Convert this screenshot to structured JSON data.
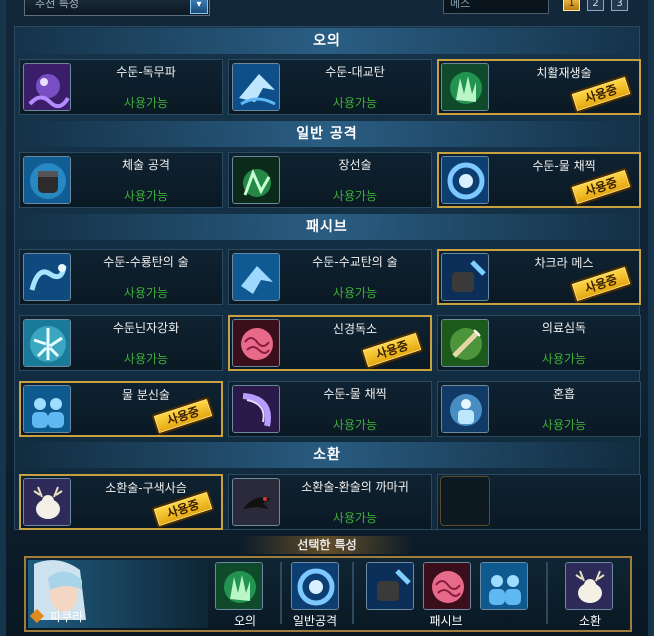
{
  "topbar": {
    "dropdown_label": "추천 특성",
    "currency_label": "메스",
    "pages": [
      "1",
      "2",
      "3"
    ]
  },
  "sections": {
    "ougi": "오의",
    "normal": "일반 공격",
    "passive": "패시브",
    "summon": "소환"
  },
  "status": {
    "available": "사용가능",
    "in_use": "사용중"
  },
  "skills": {
    "s1": {
      "name": "수둔-독무파",
      "icon": "wave-yin-yang-icon"
    },
    "s2": {
      "name": "수둔-대교탄",
      "icon": "shark-icon"
    },
    "s3": {
      "name": "치활재생술",
      "icon": "healing-hand-icon"
    },
    "s4": {
      "name": "체술 공격",
      "icon": "fist-icon"
    },
    "s5": {
      "name": "장선술",
      "icon": "green-hand-icon"
    },
    "s6": {
      "name": "수둔-물 채찍",
      "icon": "water-whirl-icon"
    },
    "s7": {
      "name": "수둔-수룡탄의 술",
      "icon": "water-dragon-icon"
    },
    "s8": {
      "name": "수둔-수교탄의 술",
      "icon": "water-shark-icon"
    },
    "s9": {
      "name": "차크라 메스",
      "icon": "chakra-scalpel-icon"
    },
    "s10": {
      "name": "수둔닌자강화",
      "icon": "water-kanji-icon"
    },
    "s11": {
      "name": "신경독소",
      "icon": "brain-icon"
    },
    "s12": {
      "name": "의료심독",
      "icon": "syringe-icon"
    },
    "s13": {
      "name": "물 분신술",
      "icon": "water-clone-icon"
    },
    "s14": {
      "name": "수둔-물 채찍",
      "icon": "water-whip-icon"
    },
    "s15": {
      "name": "혼흡",
      "icon": "blue-aura-icon"
    },
    "s16": {
      "name": "소환술-구색사슴",
      "icon": "white-deer-icon"
    },
    "s17": {
      "name": "소환술-환술의 까마귀",
      "icon": "crow-icon"
    }
  },
  "selected": {
    "title": "선택한 특성",
    "character": "파쿠라",
    "labels": {
      "ougi": "오의",
      "normal": "일반공격",
      "passive": "패시브",
      "summon": "소환"
    }
  },
  "colors": {
    "available_text": "#3fae3a",
    "stamp_fill": "#f2c23a",
    "active_border": "#c9a13e"
  }
}
